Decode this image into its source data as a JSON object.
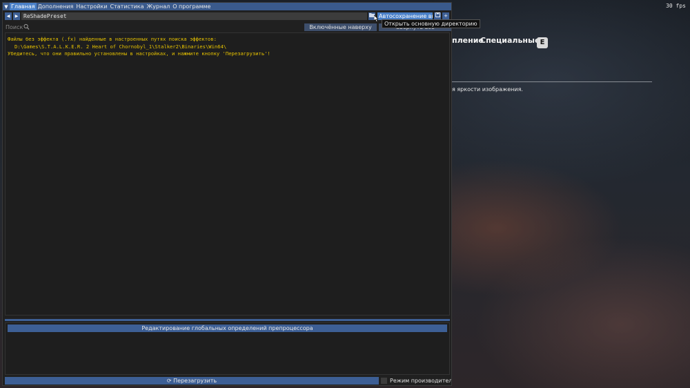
{
  "game": {
    "fps": "30 fps",
    "tab_partial": "пление",
    "tab_special": "Специальные",
    "key_hint": "E",
    "description_partial": "я яркости изображения."
  },
  "menu": {
    "items": [
      "Главная",
      "Дополнения",
      "Настройки",
      "Статистика",
      "Журнал",
      "О программе"
    ],
    "active": "Главная"
  },
  "toolbar": {
    "preset_value": "ReShadePreset",
    "autosave_label": "Автосохранение вкл",
    "tooltip": "Открыть основную директорию"
  },
  "search": {
    "placeholder": "Поиск",
    "btn_enabled_on_top": "Включённые наверху",
    "btn_collapse_all": "Свернуть все"
  },
  "messages": {
    "line1": "Файлы без эффекта (.fx) найденные в настроенных путях поиска эффектов:",
    "line2": "D:\\Games\\S.T.A.L.K.E.R. 2 Heart of Chornobyl_1\\Stalker2\\Binaries\\Win64\\",
    "line3": "Убедитесь, что они правильно установлены в настройках, и нажмите кнопку 'Перезагрузить'!"
  },
  "preprocessor": {
    "header": "Редактирование глобальных определений препроцессора"
  },
  "footer": {
    "reload_label": "Перезагрузить",
    "perf_mode_label": "Режим производительности"
  },
  "colors": {
    "accent": "#3d5f95",
    "active_tab": "#4a80c8",
    "warning_text": "#e6c200"
  }
}
